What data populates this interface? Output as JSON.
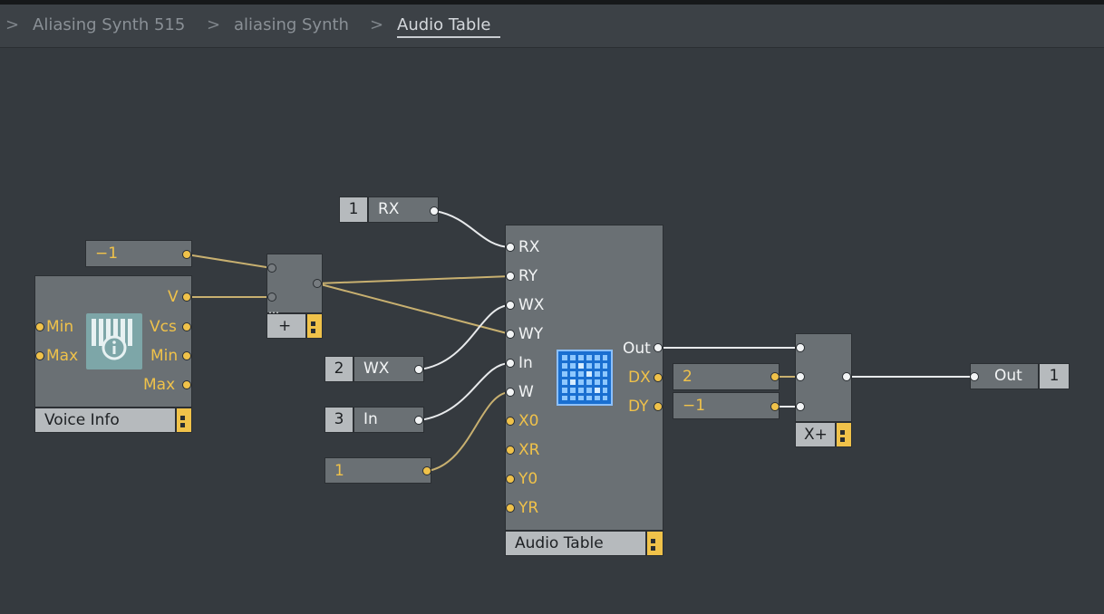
{
  "breadcrumb": {
    "items": [
      "Aliasing Synth 515",
      "aliasing Synth",
      "Audio Table"
    ]
  },
  "voice_info": {
    "title": "Voice Info",
    "outputs": [
      "V",
      "Vcs",
      "Min",
      "Max"
    ],
    "inputs": [
      "Min",
      "Max"
    ],
    "icon": "info-icon"
  },
  "const_neg1_top": "−1",
  "adder": {
    "title": "+"
  },
  "knob_rx": {
    "number": "1",
    "label": "RX"
  },
  "knob_wx": {
    "number": "2",
    "label": "WX"
  },
  "knob_in": {
    "number": "3",
    "label": "In"
  },
  "const_one": "1",
  "audio_table": {
    "title": "Audio Table",
    "inputs": [
      "RX",
      "RY",
      "WX",
      "WY",
      "In",
      "W",
      "X0",
      "XR",
      "Y0",
      "YR"
    ],
    "outputs": [
      "Out",
      "DX",
      "DY"
    ],
    "icon": "grid-table-icon"
  },
  "const_dx": "2",
  "const_dy": "−1",
  "xplus": {
    "title": "X+"
  },
  "out_terminal": {
    "label": "Out",
    "number": "1"
  },
  "colors": {
    "background": "#353a3f",
    "module": "#6a7074",
    "port_yellow": "#f0c24a",
    "port_white": "#f2f4f5",
    "wire_yellow": "#c8b070",
    "wire_white": "#e8eaec"
  }
}
